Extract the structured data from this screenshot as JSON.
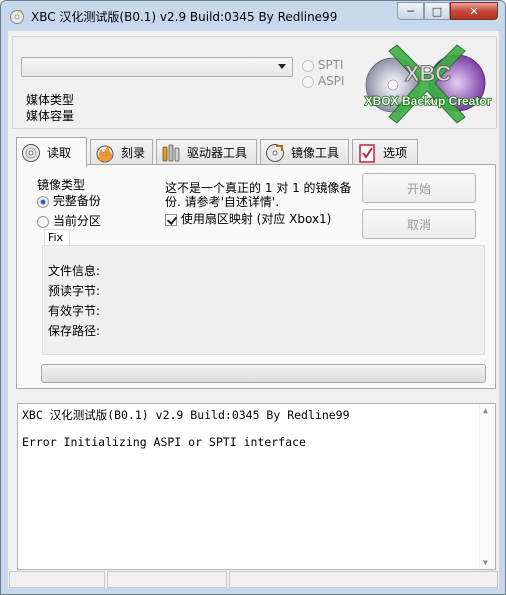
{
  "window": {
    "title": "XBC 汉化测试版(B0.1) v2.9 Build:0345 By Redline99",
    "minimize_glyph": "─",
    "maximize_glyph": "□",
    "close_glyph": "✕"
  },
  "top": {
    "drive_select_value": "",
    "spti_label": "SPTI",
    "aspi_label": "ASPI",
    "media_type_label": "媒体类型",
    "media_capacity_label": "媒体容量",
    "logo_text_1": "XBC",
    "logo_text_2": "XBOX Backup Creator"
  },
  "tabs": [
    {
      "label": "读取",
      "icon": "disc-read-icon",
      "active": true
    },
    {
      "label": "刻录",
      "icon": "disc-burn-icon",
      "active": false
    },
    {
      "label": "驱动器工具",
      "icon": "drive-tools-icon",
      "active": false
    },
    {
      "label": "镜像工具",
      "icon": "image-tools-icon",
      "active": false
    },
    {
      "label": "选项",
      "icon": "options-checklist-icon",
      "active": false
    }
  ],
  "read_tab": {
    "image_type_label": "镜像类型",
    "full_backup_label": "完整备份",
    "full_backup_selected": true,
    "current_partition_label": "当前分区",
    "current_partition_selected": false,
    "notice_line1": "这不是一个真正的 1 对 1 的镜像备",
    "notice_line2": "份. 请参考'自述详情'.",
    "sector_map_label": "使用扇区映射 (对应 Xbox1)",
    "sector_map_checked": true,
    "fix_tab_label": "Fix",
    "start_button": "开始",
    "cancel_button": "取消",
    "file_info_label": "文件信息:",
    "preread_bytes_label": "预读字节:",
    "valid_bytes_label": "有效字节:",
    "save_path_label": "保存路径:",
    "progress": 0
  },
  "log": {
    "lines": [
      "XBC 汉化测试版(B0.1) v2.9 Build:0345 By Redline99",
      "",
      "Error Initializing ASPI or SPTI interface"
    ],
    "scroll_up": "▲",
    "scroll_down": "▼"
  },
  "status_bar": {
    "segments": [
      "",
      "",
      ""
    ]
  },
  "colors": {
    "frame": "#c7d8ec",
    "client": "#f0f0f0",
    "close_button": "#c9483a",
    "logo_green": "#3cb043",
    "logo_purple": "#8a4fb4"
  }
}
